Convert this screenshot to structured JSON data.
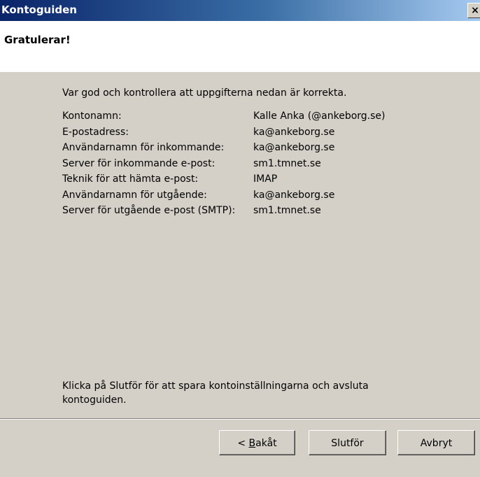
{
  "window": {
    "title": "Kontoguiden",
    "close_symbol": "×"
  },
  "header": {
    "title": "Gratulerar!"
  },
  "intro": "Var god och kontrollera att uppgifterna nedan är korrekta.",
  "rows": [
    {
      "label": "Kontonamn:",
      "value": "Kalle Anka (@ankeborg.se)"
    },
    {
      "label": "E-postadress:",
      "value": "ka@ankeborg.se"
    },
    {
      "label": "Användarnamn för inkommande:",
      "value": "ka@ankeborg.se"
    },
    {
      "label": "Server för inkommande e-post:",
      "value": "sm1.tmnet.se"
    },
    {
      "label": "Teknik för att hämta e-post:",
      "value": "IMAP"
    },
    {
      "label": "Användarnamn för utgående:",
      "value": "ka@ankeborg.se"
    },
    {
      "label": "Server för utgående e-post (SMTP):",
      "value": "sm1.tmnet.se"
    }
  ],
  "finish_text": "Klicka på Slutför för att spara kontoinställningarna och avsluta kontoguiden.",
  "buttons": {
    "back_prefix": "< ",
    "back_mnemonic": "B",
    "back_rest": "akåt",
    "finish": "Slutför",
    "cancel": "Avbryt"
  }
}
